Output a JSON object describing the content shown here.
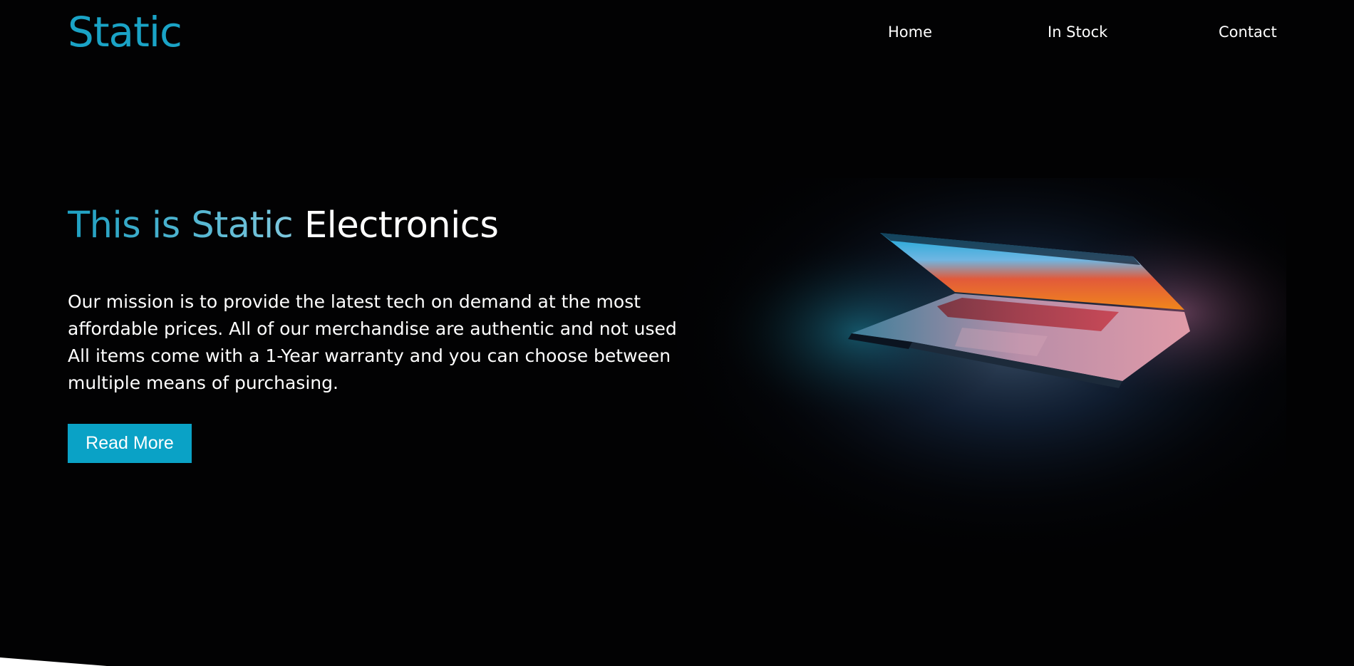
{
  "header": {
    "logo": "Static",
    "nav": {
      "home": "Home",
      "in_stock": "In Stock",
      "contact": "Contact"
    }
  },
  "hero": {
    "title_accent": "This is Static",
    "title_plain": "Electronics",
    "description": "Our mission is to provide the latest tech on demand at the most affordable prices. All of our merchandise are authentic and not used. All items come with a 1-Year warranty and you can choose between multiple means of purchasing.",
    "button_label": "Read More"
  },
  "colors": {
    "background": "#020203",
    "accent": "#1aa3c6",
    "button": "#0aa2c6",
    "text": "#ffffff"
  },
  "icons": {
    "hero_image": "laptop-icon"
  }
}
